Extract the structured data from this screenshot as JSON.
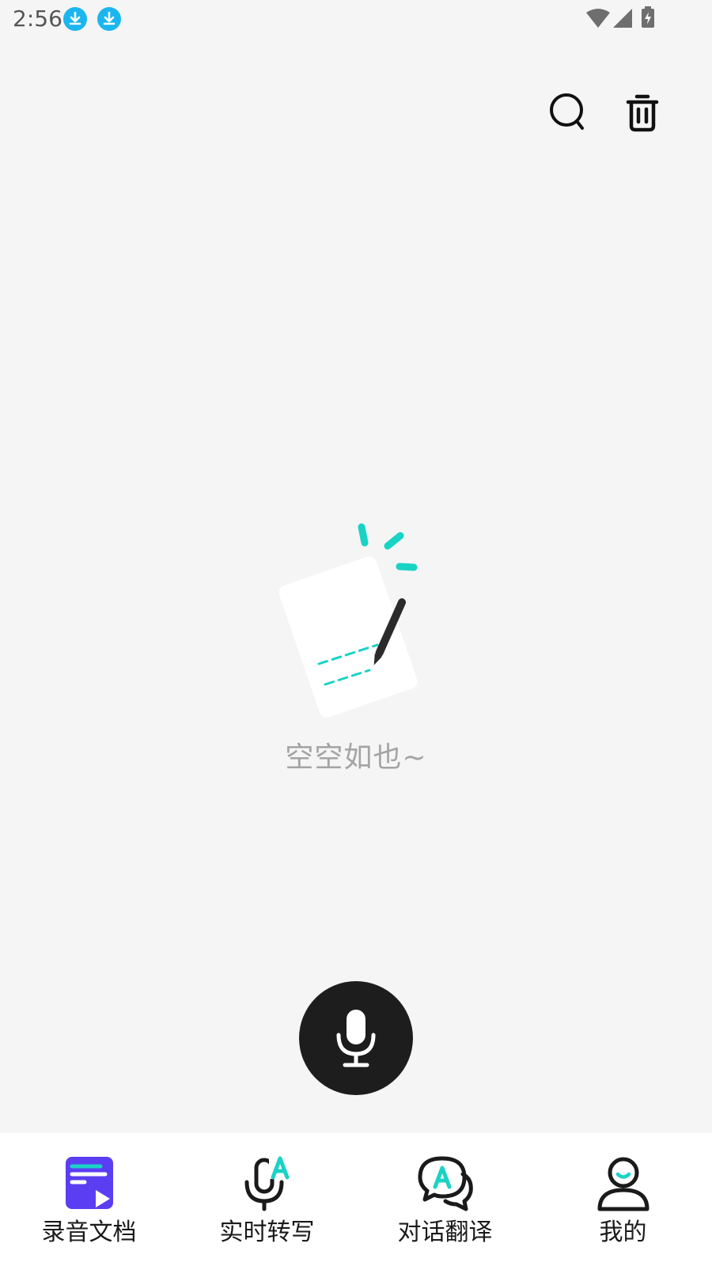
{
  "status_bar": {
    "time": "2:56",
    "icons": [
      "download-icon",
      "download-icon",
      "wifi-icon",
      "signal-icon",
      "battery-charging-icon"
    ]
  },
  "toolbar": {
    "icons": [
      "search-icon",
      "trash-icon"
    ]
  },
  "empty_state": {
    "message": "空空如也~",
    "illustration": "note-pen-icon"
  },
  "record_button": {
    "icon": "microphone-icon"
  },
  "bottom_nav": {
    "items": [
      {
        "label": "录音文档",
        "icon": "recording-doc-icon",
        "active": true
      },
      {
        "label": "实时转写",
        "icon": "live-transcribe-icon",
        "active": false
      },
      {
        "label": "对话翻译",
        "icon": "dialogue-translate-icon",
        "active": false
      },
      {
        "label": "我的",
        "icon": "profile-icon",
        "active": false
      }
    ]
  },
  "colors": {
    "accent_teal": "#19d3c5",
    "accent_purple": "#5b3ef2",
    "background": "#f5f5f5",
    "record_button": "#1d1d1d",
    "status_download": "#1bb6f0"
  }
}
